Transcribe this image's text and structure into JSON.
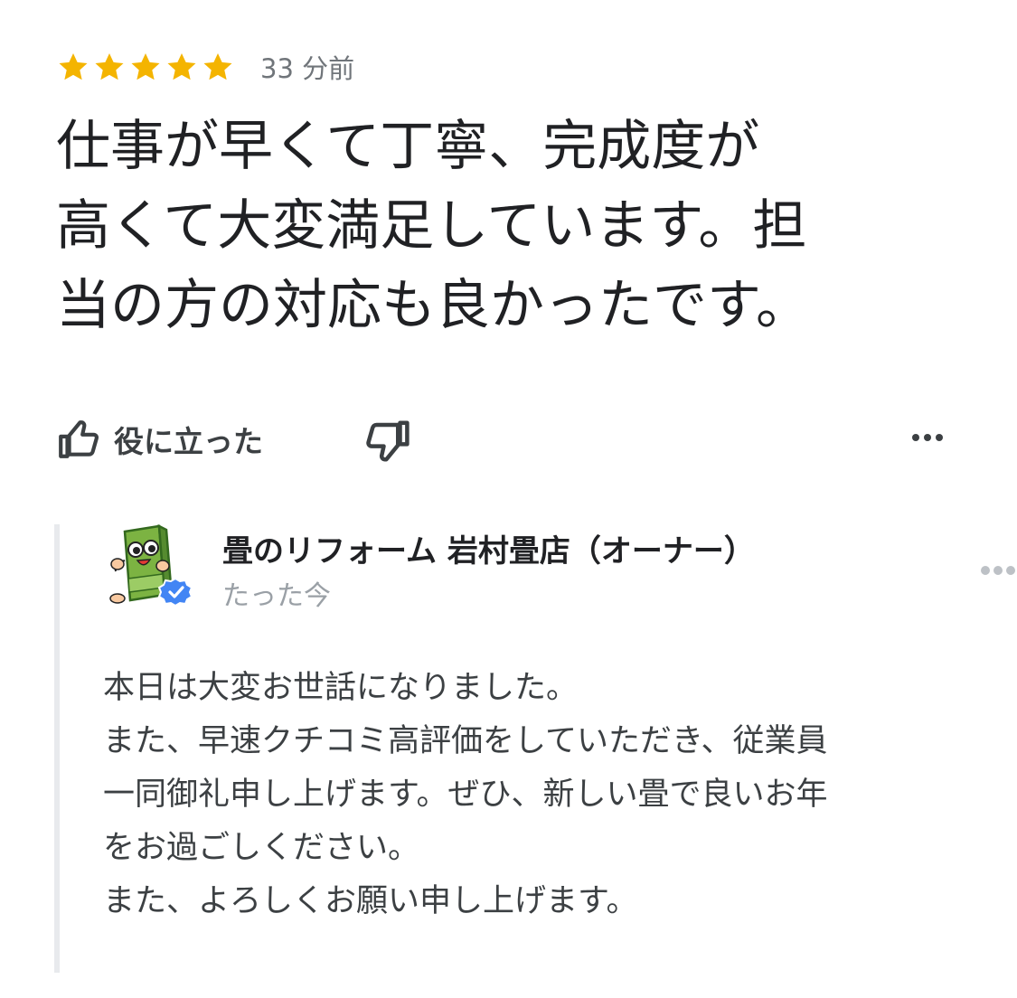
{
  "review": {
    "rating": 5,
    "max_rating": 5,
    "time": "33 分前",
    "text": "仕事が早くて丁寧、完成度が高くて大変満足しています。担当の方の対応も良かったです。",
    "text_lines": [
      "仕事が早くて丁寧、完成度が",
      "高くて大変満足しています。担",
      "当の方の対応も良かったです。"
    ]
  },
  "actions": {
    "helpful_label": "役に立った",
    "thumbs_up_icon": "thumbs-up-icon",
    "thumbs_down_icon": "thumbs-down-icon",
    "more_icon": "more-horizontal-icon"
  },
  "owner_response": {
    "name": "畳のリフォーム 岩村畳店（オーナー）",
    "time": "たった今",
    "verified_icon": "verified-badge-icon",
    "avatar_icon": "tatami-mascot-icon",
    "lines": [
      "本日は大変お世話になりました。",
      "また、早速クチコミ高評価をしていただき、従業員",
      "一同御礼申し上げます。ぜひ、新しい畳で良いお年",
      "をお過ごしください。",
      "また、よろしくお願い申し上げます。"
    ]
  },
  "colors": {
    "star": "#f4b400",
    "text_primary": "#202124",
    "text_secondary": "#70757a",
    "verified": "#4285f4",
    "bar": "#e8eaed",
    "avatar_green": "#7cb342"
  }
}
